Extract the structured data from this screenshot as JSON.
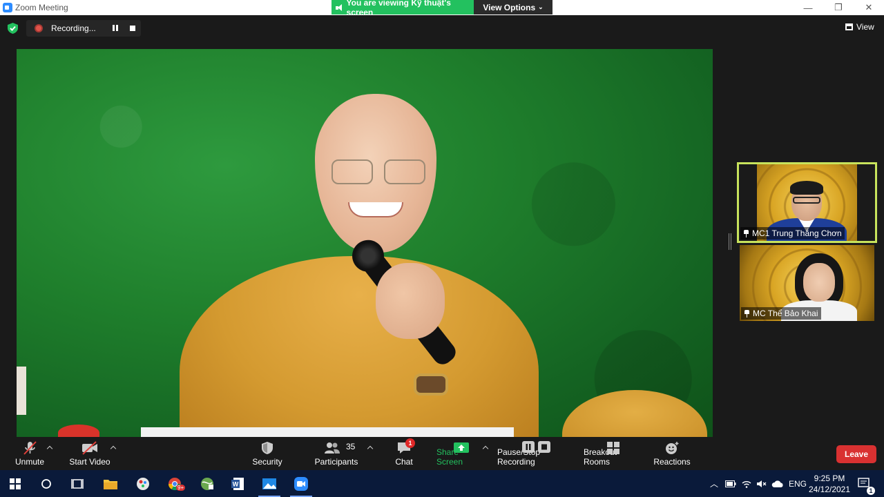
{
  "window": {
    "title": "Zoom Meeting",
    "viewing_banner": "You are viewing Kỹ thuật's screen",
    "view_options": "View Options",
    "controls": {
      "minimize": "—",
      "restore": "❐",
      "close": "✕"
    }
  },
  "meeting_bar": {
    "recording_label": "Recording...",
    "view_label": "View"
  },
  "participants_panel": [
    {
      "name": "MC1 Trung Thắng Chơn",
      "highlighted": true
    },
    {
      "name": "MC Thể Bảo Khai",
      "highlighted": false
    }
  ],
  "toolbar": {
    "unmute": "Unmute",
    "start_video": "Start Video",
    "security": "Security",
    "participants": "Participants",
    "participants_count": "35",
    "chat": "Chat",
    "chat_badge": "1",
    "share_screen": "Share Screen",
    "pause_stop_recording": "Pause/Stop Recording",
    "breakout_rooms": "Breakout Rooms",
    "reactions": "Reactions",
    "leave": "Leave"
  },
  "taskbar": {
    "language": "ENG",
    "time": "9:25 PM",
    "date": "24/12/2021",
    "notification_count": "1",
    "chrome_badge": "9+"
  },
  "colors": {
    "accent_green": "#23c15f",
    "leave_red": "#d93131",
    "active_speaker_border": "#c8e35c"
  }
}
